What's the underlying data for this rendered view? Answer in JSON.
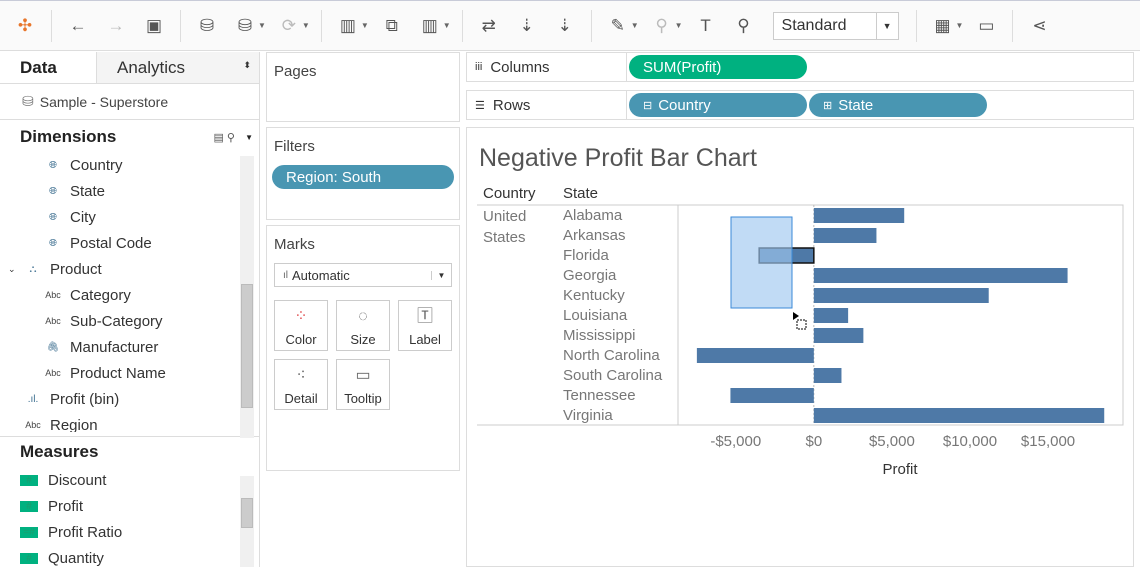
{
  "toolbar": {
    "mark_type_select": "Standard"
  },
  "left": {
    "tabs": [
      "Data",
      "Analytics"
    ],
    "source": "Sample - Superstore",
    "dimensions_title": "Dimensions",
    "measures_title": "Measures",
    "dimensions": [
      {
        "label": "Country",
        "icon": "globe",
        "indent": 1
      },
      {
        "label": "State",
        "icon": "globe",
        "indent": 1
      },
      {
        "label": "City",
        "icon": "globe",
        "indent": 1
      },
      {
        "label": "Postal Code",
        "icon": "globe",
        "indent": 1
      },
      {
        "label": "Product",
        "icon": "hierarchy",
        "indent": 0
      },
      {
        "label": "Category",
        "icon": "Abc",
        "indent": 1
      },
      {
        "label": "Sub-Category",
        "icon": "Abc",
        "indent": 1
      },
      {
        "label": "Manufacturer",
        "icon": "clip",
        "indent": 1
      },
      {
        "label": "Product Name",
        "icon": "Abc",
        "indent": 1
      },
      {
        "label": "Profit (bin)",
        "icon": "bin",
        "indent": 0
      },
      {
        "label": "Region",
        "icon": "Abc",
        "indent": 0
      }
    ],
    "measures": [
      {
        "label": "Discount",
        "icon": "#"
      },
      {
        "label": "Profit",
        "icon": "#"
      },
      {
        "label": "Profit Ratio",
        "icon": "=#"
      },
      {
        "label": "Quantity",
        "icon": "#"
      }
    ]
  },
  "pages": {
    "title": "Pages"
  },
  "filters": {
    "title": "Filters",
    "items": [
      "Region: South"
    ]
  },
  "marks": {
    "title": "Marks",
    "type": "Automatic",
    "buttons": [
      "Color",
      "Size",
      "Label",
      "Detail",
      "Tooltip"
    ]
  },
  "shelves": {
    "columns_label": "Columns",
    "rows_label": "Rows",
    "columns": [
      "SUM(Profit)"
    ],
    "rows": [
      "Country",
      "State"
    ]
  },
  "chart_data": {
    "type": "bar",
    "title": "Negative Profit Bar Chart",
    "row_headers": [
      "Country",
      "State"
    ],
    "country": "United States",
    "categories": [
      "Alabama",
      "Arkansas",
      "Florida",
      "Georgia",
      "Kentucky",
      "Louisiana",
      "Mississippi",
      "North Carolina",
      "South Carolina",
      "Tennessee",
      "Virginia"
    ],
    "values": [
      5787,
      4009,
      -3502,
      16250,
      11200,
      2196,
      3172,
      -7491,
      1769,
      -5342,
      18598
    ],
    "highlighted": "Florida",
    "xlabel": "Profit",
    "xlim": [
      -8700,
      19800
    ],
    "ticks": [
      -5000,
      0,
      5000,
      10000,
      15000
    ],
    "tick_labels": [
      "-$5,000",
      "$0",
      "$5,000",
      "$10,000",
      "$15,000"
    ],
    "bar_color": "#4e79a7"
  }
}
